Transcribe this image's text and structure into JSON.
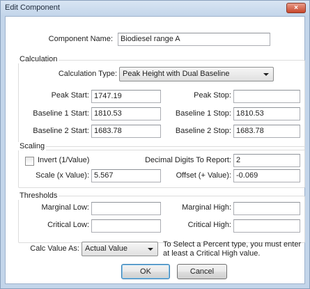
{
  "window": {
    "title": "Edit Component",
    "close_label": "×"
  },
  "component": {
    "name_label": "Component Name:",
    "name_value": "Biodiesel range A"
  },
  "calculation": {
    "group_title": "Calculation",
    "type_label": "Calculation Type:",
    "type_value": "Peak Height with Dual Baseline",
    "peak_start_label": "Peak Start:",
    "peak_start_value": "1747.19",
    "peak_stop_label": "Peak Stop:",
    "peak_stop_value": "",
    "baseline1_start_label": "Baseline 1 Start:",
    "baseline1_start_value": "1810.53",
    "baseline1_stop_label": "Baseline 1 Stop:",
    "baseline1_stop_value": "1810.53",
    "baseline2_start_label": "Baseline 2 Start:",
    "baseline2_start_value": "1683.78",
    "baseline2_stop_label": "Baseline 2 Stop:",
    "baseline2_stop_value": "1683.78"
  },
  "scaling": {
    "group_title": "Scaling",
    "invert_label": "Invert (1/Value)",
    "invert_checked": false,
    "decimal_label": "Decimal Digits To Report:",
    "decimal_value": "2",
    "scale_label": "Scale (x Value):",
    "scale_value": "5.567",
    "offset_label": "Offset (+ Value):",
    "offset_value": "-0.069"
  },
  "thresholds": {
    "group_title": "Thresholds",
    "marginal_low_label": "Marginal Low:",
    "marginal_low_value": "",
    "marginal_high_label": "Marginal High:",
    "marginal_high_value": "",
    "critical_low_label": "Critical Low:",
    "critical_low_value": "",
    "critical_high_label": "Critical High:",
    "critical_high_value": ""
  },
  "calc_value": {
    "label": "Calc Value As:",
    "value": "Actual Value",
    "note_line1": "To Select a Percent type, you must enter",
    "note_line2": "at least a Critical High value."
  },
  "buttons": {
    "ok": "OK",
    "cancel": "Cancel"
  },
  "colors": {
    "frame": "#c3d5ea",
    "close": "#c7462b",
    "default_button_border": "#3c7fb1"
  },
  "icons": {
    "close": "close-icon",
    "dropdown": "chevron-down-icon"
  }
}
